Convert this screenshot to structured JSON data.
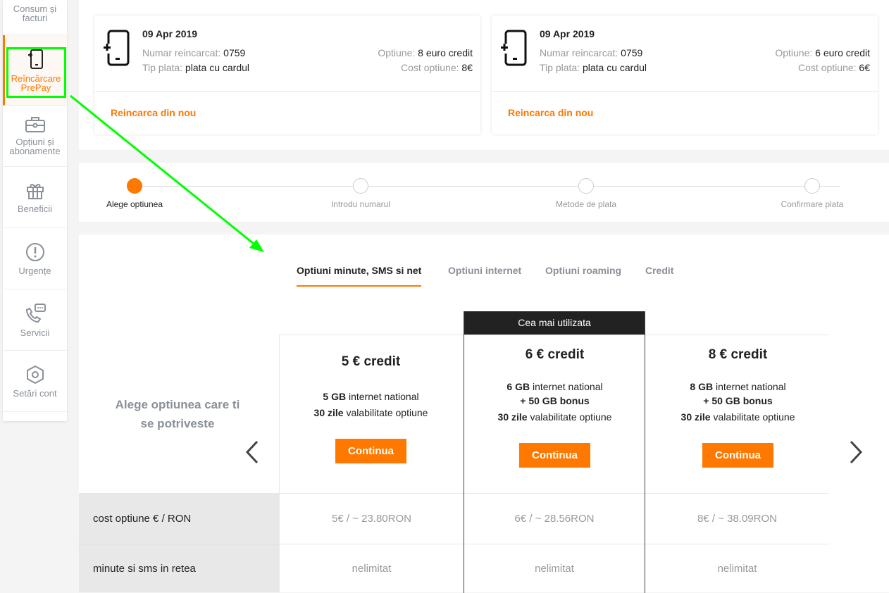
{
  "sidebar": {
    "items": [
      {
        "label": "Consum și facturi",
        "icon": "invoice-icon"
      },
      {
        "label": "Reîncărcare PrePay",
        "icon": "phone-recharge-icon",
        "active": true
      },
      {
        "label": "Opțiuni și abonamente",
        "icon": "briefcase-icon"
      },
      {
        "label": "Beneficii",
        "icon": "gift-icon"
      },
      {
        "label": "Urgențe",
        "icon": "alert-icon"
      },
      {
        "label": "Servicii",
        "icon": "phone-chat-icon"
      },
      {
        "label": "Setări cont",
        "icon": "settings-icon"
      }
    ]
  },
  "history": [
    {
      "date": "09 Apr 2019",
      "number_label": "Numar reincarcat:",
      "number": "0759",
      "pay_label": "Tip plata:",
      "pay": "plata cu cardul",
      "option_label": "Optiune:",
      "option": "8 euro credit",
      "cost_label": "Cost optiune:",
      "cost": "8€",
      "link": "Reincarca din nou"
    },
    {
      "date": "09 Apr 2019",
      "number_label": "Numar reincarcat:",
      "number": "0759",
      "pay_label": "Tip plata:",
      "pay": "plata cu cardul",
      "option_label": "Optiune:",
      "option": "6 euro credit",
      "cost_label": "Cost optiune:",
      "cost": "6€",
      "link": "Reincarca din nou"
    }
  ],
  "steps": [
    "Alege optiunea",
    "Introdu numarul",
    "Metode de plata",
    "Confirmare plata"
  ],
  "current_step": 0,
  "tabs": [
    "Optiuni minute, SMS si net",
    "Optiuni internet",
    "Optiuni roaming",
    "Credit"
  ],
  "choose_text": "Alege optiunea care ti se potriveste",
  "badge": "Cea mai utilizata",
  "plans": [
    {
      "title": "5 € credit",
      "gb": "5 GB",
      "gb_text": "internet national",
      "bonus": "",
      "days": "30 zile",
      "days_text": "valabilitate optiune",
      "button": "Continua",
      "cost": "5€ / ~ 23.80RON",
      "minutes": "nelimitat"
    },
    {
      "title": "6 € credit",
      "gb": "6 GB",
      "gb_text": "internet national",
      "bonus": "+ 50 GB bonus",
      "days": "30 zile",
      "days_text": "valabilitate optiune",
      "button": "Continua",
      "cost": "6€ / ~ 28.56RON",
      "minutes": "nelimitat"
    },
    {
      "title": "8 € credit",
      "gb": "8 GB",
      "gb_text": "internet national",
      "bonus": "+ 50 GB bonus",
      "days": "30 zile",
      "days_text": "valabilitate optiune",
      "button": "Continua",
      "cost": "8€ / ~ 38.09RON",
      "minutes": "nelimitat"
    }
  ],
  "rows": [
    "cost optiune € / RON",
    "minute si sms in retea"
  ],
  "colors": {
    "accent": "#ff7900",
    "annotation": "#00ff00"
  }
}
